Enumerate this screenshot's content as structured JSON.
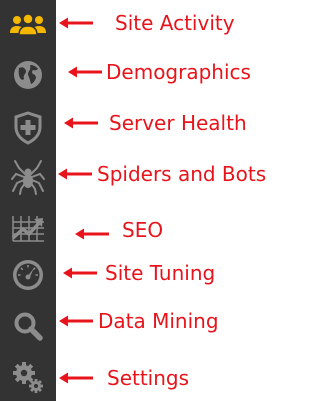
{
  "sidebar": {
    "background": "#333333",
    "items": [
      {
        "icon": "users-icon",
        "label": "Site Activity",
        "active": true,
        "icon_color": "#f5b800"
      },
      {
        "icon": "globe-icon",
        "label": "Demographics",
        "active": false,
        "icon_color": "#8c8c8c"
      },
      {
        "icon": "shield-plus-icon",
        "label": "Server Health",
        "active": false,
        "icon_color": "#8c8c8c"
      },
      {
        "icon": "spider-icon",
        "label": "Spiders and Bots",
        "active": false,
        "icon_color": "#8c8c8c"
      },
      {
        "icon": "chart-trend-icon",
        "label": "SEO",
        "active": false,
        "icon_color": "#8c8c8c"
      },
      {
        "icon": "speedometer-icon",
        "label": "Site Tuning",
        "active": false,
        "icon_color": "#8c8c8c"
      },
      {
        "icon": "search-icon",
        "label": "Data Mining",
        "active": false,
        "icon_color": "#8c8c8c"
      },
      {
        "icon": "gears-icon",
        "label": "Settings",
        "active": false,
        "icon_color": "#8c8c8c"
      }
    ]
  },
  "annotation_color": "#e8141c"
}
